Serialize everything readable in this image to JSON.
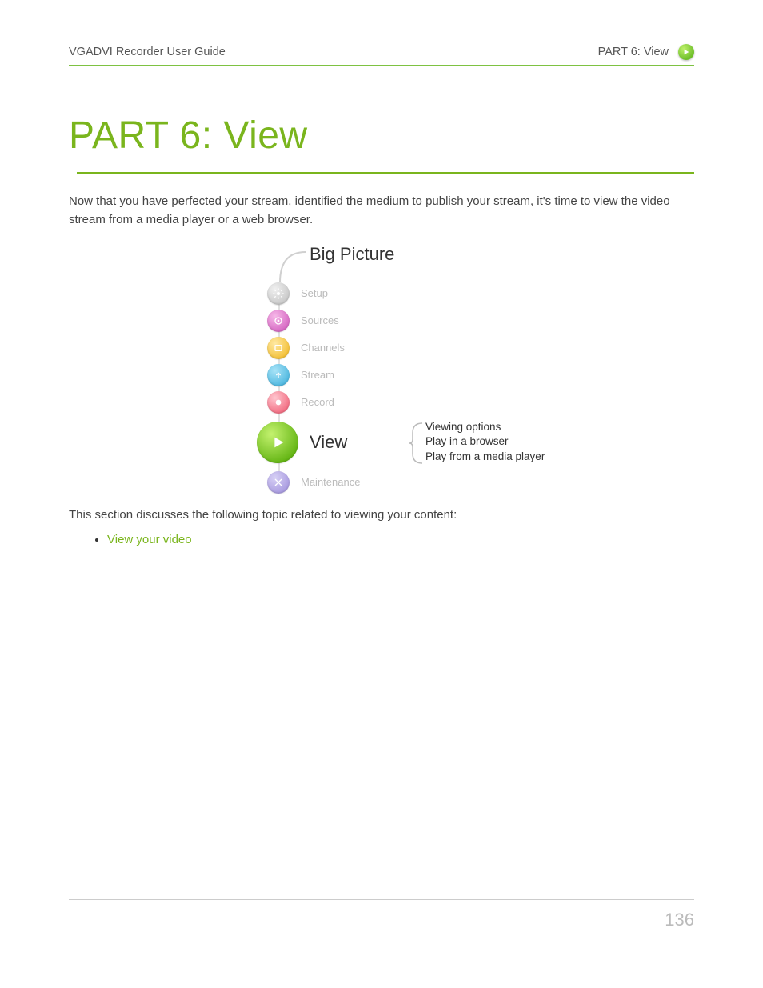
{
  "header": {
    "left": "VGADVI Recorder User Guide",
    "right": "PART 6: View"
  },
  "title": "PART 6:   View",
  "intro": "Now that you have perfected your stream, identified the medium to publish your stream, it's time to view the video stream from a media player or a web browser.",
  "diagram": {
    "title": "Big Picture",
    "steps": [
      {
        "label": "Setup"
      },
      {
        "label": "Sources"
      },
      {
        "label": "Channels"
      },
      {
        "label": "Stream"
      },
      {
        "label": "Record"
      },
      {
        "label": "View"
      },
      {
        "label": "Maintenance"
      }
    ],
    "sub": [
      "Viewing options",
      "Play in a browser",
      "Play from a media player"
    ]
  },
  "after": "This section discusses the following topic related to viewing your content:",
  "topics": [
    "View your video"
  ],
  "page_number": "136"
}
